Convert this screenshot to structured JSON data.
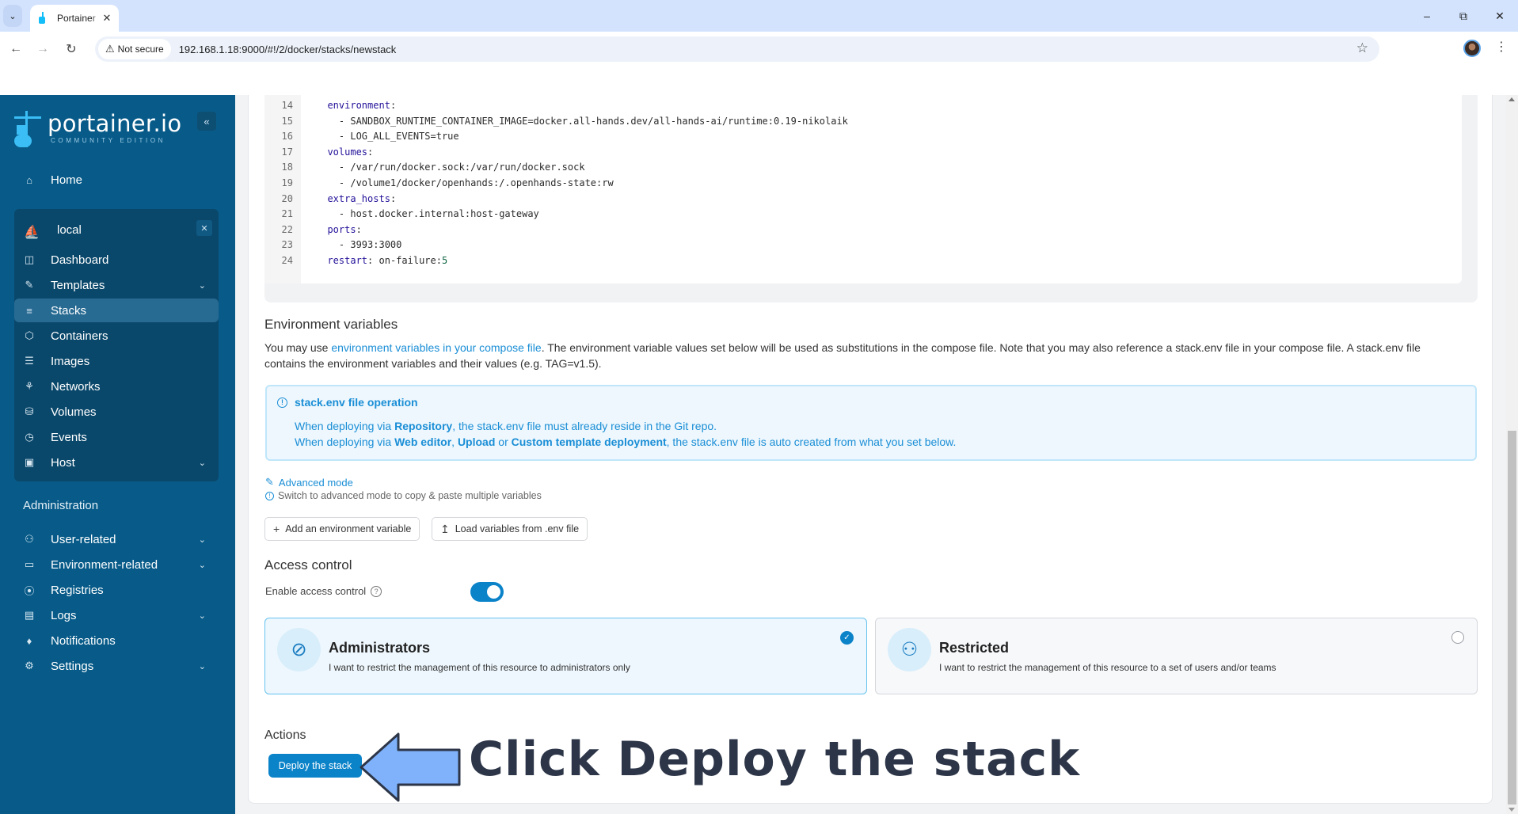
{
  "browser": {
    "tab_title": "Portainer",
    "security_label": "Not secure",
    "url": "192.168.1.18:9000/#!/2/docker/stacks/newstack",
    "icons": {
      "tab_list": "chevron-down-icon",
      "tab_close": "close-icon",
      "back": "arrow-left-icon",
      "forward": "arrow-right-icon",
      "reload": "reload-icon",
      "warning": "warning-triangle-icon",
      "bookmark": "star-icon",
      "profile": "avatar",
      "menu": "kebab-menu-icon",
      "minimize": "minimize-icon",
      "restore": "restore-icon",
      "close_window": "close-icon"
    }
  },
  "sidebar": {
    "brand": "portainer.io",
    "edition": "COMMUNITY EDITION",
    "collapse_icon": "double-chevron-left-icon",
    "home": {
      "label": "Home",
      "icon": "home-icon"
    },
    "environment": {
      "name": "local",
      "icon": "docker-whale-icon",
      "items": [
        {
          "label": "Dashboard",
          "icon": "dashboard-icon",
          "expandable": false,
          "active": false
        },
        {
          "label": "Templates",
          "icon": "edit-icon",
          "expandable": true,
          "active": false
        },
        {
          "label": "Stacks",
          "icon": "layers-icon",
          "expandable": false,
          "active": true
        },
        {
          "label": "Containers",
          "icon": "box-icon",
          "expandable": false,
          "active": false
        },
        {
          "label": "Images",
          "icon": "list-icon",
          "expandable": false,
          "active": false
        },
        {
          "label": "Networks",
          "icon": "network-icon",
          "expandable": false,
          "active": false
        },
        {
          "label": "Volumes",
          "icon": "database-icon",
          "expandable": false,
          "active": false
        },
        {
          "label": "Events",
          "icon": "clock-icon",
          "expandable": false,
          "active": false
        },
        {
          "label": "Host",
          "icon": "host-icon",
          "expandable": true,
          "active": false
        }
      ]
    },
    "admin_heading": "Administration",
    "admin_items": [
      {
        "label": "User-related",
        "icon": "users-icon",
        "expandable": true
      },
      {
        "label": "Environment-related",
        "icon": "hard-drive-icon",
        "expandable": true
      },
      {
        "label": "Registries",
        "icon": "radio-icon",
        "expandable": false
      },
      {
        "label": "Logs",
        "icon": "file-text-icon",
        "expandable": true
      },
      {
        "label": "Notifications",
        "icon": "bell-icon",
        "expandable": false
      },
      {
        "label": "Settings",
        "icon": "gear-icon",
        "expandable": true
      }
    ]
  },
  "editor": {
    "lines": [
      {
        "n": "14",
        "indent": "  ",
        "key": "environment",
        "sep": ":",
        "value": ""
      },
      {
        "n": "15",
        "indent": "    ",
        "key": "",
        "sep": "",
        "value": "- SANDBOX_RUNTIME_CONTAINER_IMAGE=docker.all-hands.dev/all-hands-ai/runtime:0.19-nikolaik"
      },
      {
        "n": "16",
        "indent": "    ",
        "key": "",
        "sep": "",
        "value": "- LOG_ALL_EVENTS=true"
      },
      {
        "n": "17",
        "indent": "  ",
        "key": "volumes",
        "sep": ":",
        "value": ""
      },
      {
        "n": "18",
        "indent": "    ",
        "key": "",
        "sep": "",
        "value": "- /var/run/docker.sock:/var/run/docker.sock"
      },
      {
        "n": "19",
        "indent": "    ",
        "key": "",
        "sep": "",
        "value": "- /volume1/docker/openhands:/.openhands-state:rw"
      },
      {
        "n": "20",
        "indent": "  ",
        "key": "extra_hosts",
        "sep": ":",
        "value": ""
      },
      {
        "n": "21",
        "indent": "    ",
        "key": "",
        "sep": "",
        "value": "- host.docker.internal:host-gateway"
      },
      {
        "n": "22",
        "indent": "  ",
        "key": "ports",
        "sep": ":",
        "value": ""
      },
      {
        "n": "23",
        "indent": "    ",
        "key": "",
        "sep": "",
        "value": "- 3993:3000"
      },
      {
        "n": "24",
        "indent": "  ",
        "key": "restart",
        "sep": ":",
        "value": " on-failure:",
        "num": "5"
      }
    ]
  },
  "env_vars": {
    "title": "Environment variables",
    "desc_pre": "You may use ",
    "desc_link": "environment variables in your compose file",
    "desc_post": ". The environment variable values set below will be used as substitutions in the compose file. Note that you may also reference a stack.env file in your compose file. A stack.env file contains the environment variables and their values (e.g. TAG=v1.5).",
    "info": {
      "icon": "info-circle-icon",
      "title": "stack.env file operation",
      "line1": {
        "pre": "When deploying via ",
        "b1": "Repository",
        "post": ", the stack.env file must already reside in the Git repo."
      },
      "line2": {
        "pre": "When deploying via ",
        "b1": "Web editor",
        "mid1": ", ",
        "b2": "Upload",
        "mid2": " or ",
        "b3": "Custom template deployment",
        "post": ", the stack.env file is auto created from what you set below."
      }
    },
    "advanced_mode": "Advanced mode",
    "advanced_hint": "Switch to advanced mode to copy & paste multiple variables",
    "add_button": "Add an environment variable",
    "load_button": "Load variables from .env file"
  },
  "access_control": {
    "title": "Access control",
    "enable_label": "Enable access control",
    "enabled": true,
    "options": [
      {
        "title": "Administrators",
        "desc": "I want to restrict the management of this resource to administrators only",
        "icon": "eye-off-icon",
        "selected": true
      },
      {
        "title": "Restricted",
        "desc": "I want to restrict the management of this resource to a set of users and/or teams",
        "icon": "users-icon",
        "selected": false
      }
    ]
  },
  "actions": {
    "title": "Actions",
    "deploy_button": "Deploy the stack"
  },
  "annotation": {
    "text": "Click Deploy the stack",
    "arrow_color": "#7fb2fb"
  },
  "colors": {
    "sidebar_bg": "#085b89",
    "env_box_bg": "#0a486b",
    "accent": "#0b83c9",
    "link": "#1a8ed6"
  }
}
